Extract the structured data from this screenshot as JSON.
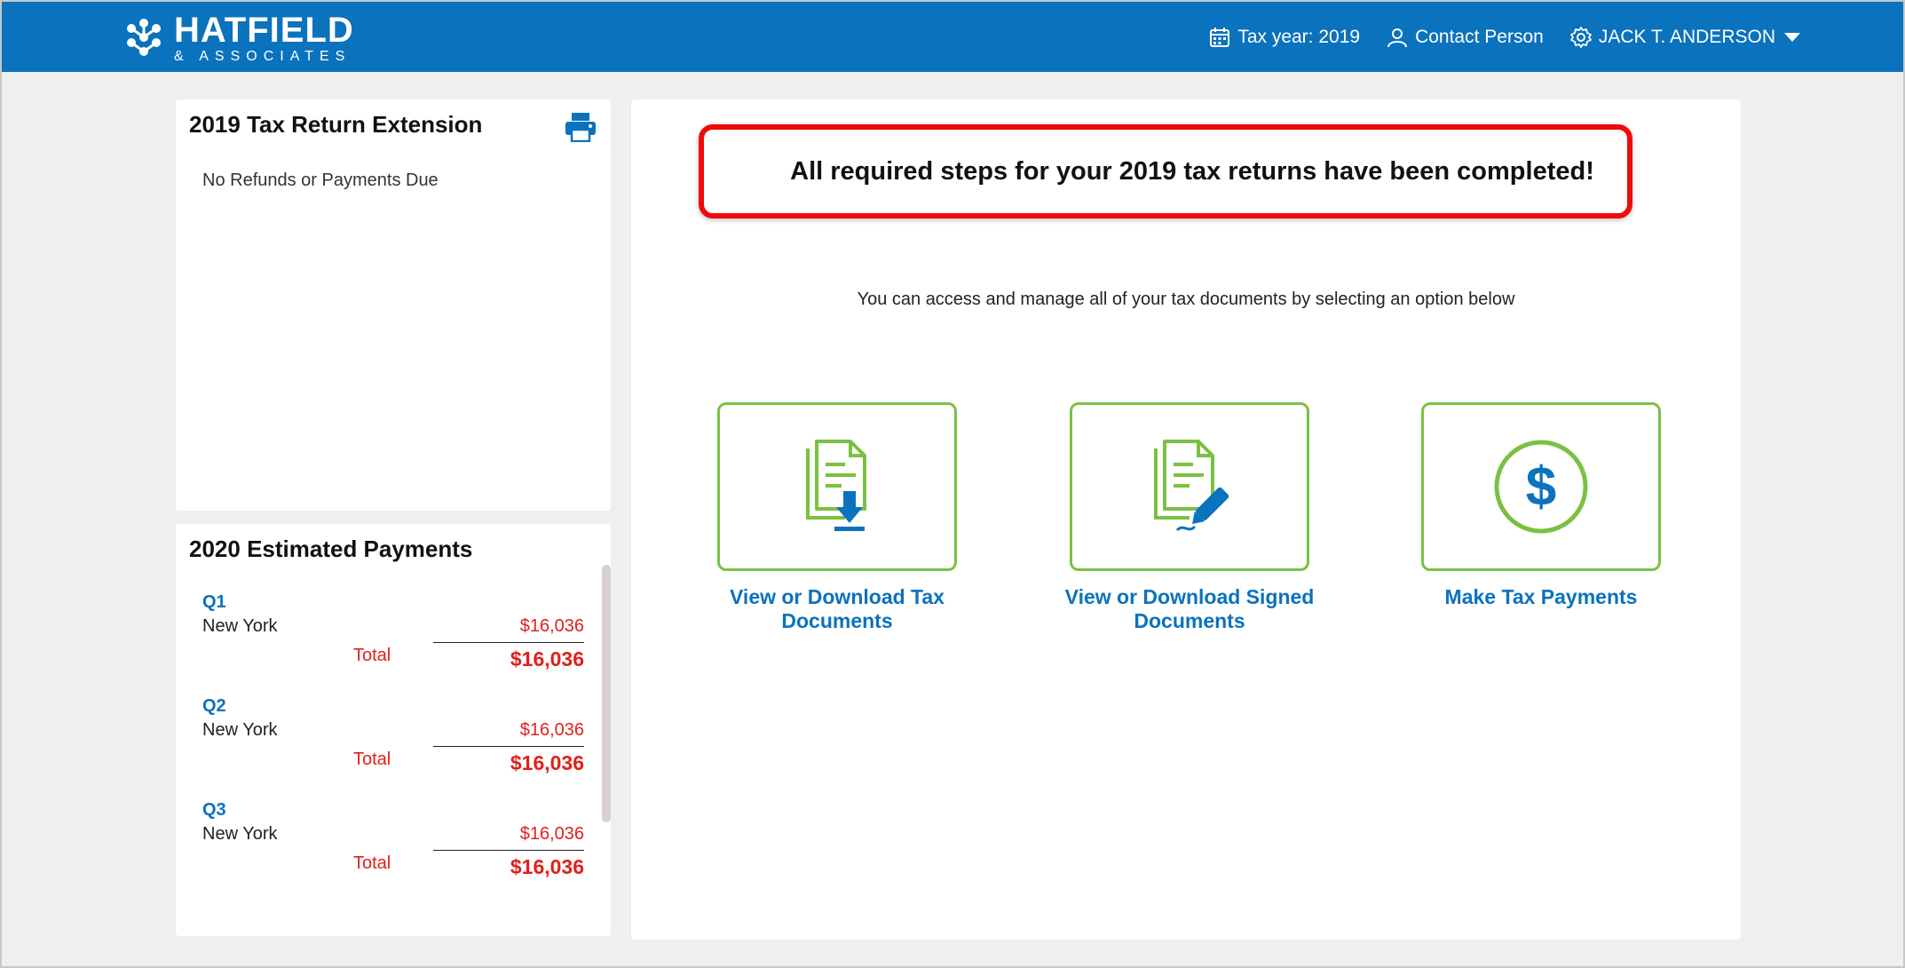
{
  "header": {
    "logo_name": "HATFIELD",
    "logo_sub": "& ASSOCIATES",
    "tax_year": "Tax year: 2019",
    "contact": "Contact Person",
    "user": "JACK T. ANDERSON",
    "bg_color": "#0b72bd"
  },
  "extension": {
    "title": "2019 Tax Return Extension",
    "note": "No Refunds or Payments Due",
    "print_icon": "printer-icon"
  },
  "estimated": {
    "title": "2020 Estimated Payments",
    "quarters": [
      {
        "label": "Q1",
        "state": "New York",
        "amount": "$16,036",
        "total_label": "Total",
        "total": "$16,036"
      },
      {
        "label": "Q2",
        "state": "New York",
        "amount": "$16,036",
        "total_label": "Total",
        "total": "$16,036"
      },
      {
        "label": "Q3",
        "state": "New York",
        "amount": "$16,036",
        "total_label": "Total",
        "total": "$16,036"
      }
    ]
  },
  "main": {
    "banner": "All required steps for your 2019 tax returns have been completed!",
    "subtext": "You can access and manage all of your tax documents by selecting an option below",
    "options": [
      {
        "label": "View or Download Tax Documents",
        "icon": "document-download-icon"
      },
      {
        "label": "View or Download Signed Documents",
        "icon": "document-sign-icon"
      },
      {
        "label": "Make Tax Payments",
        "icon": "dollar-icon"
      }
    ],
    "accent_green": "#7ac143",
    "accent_red": "#e0201b"
  }
}
